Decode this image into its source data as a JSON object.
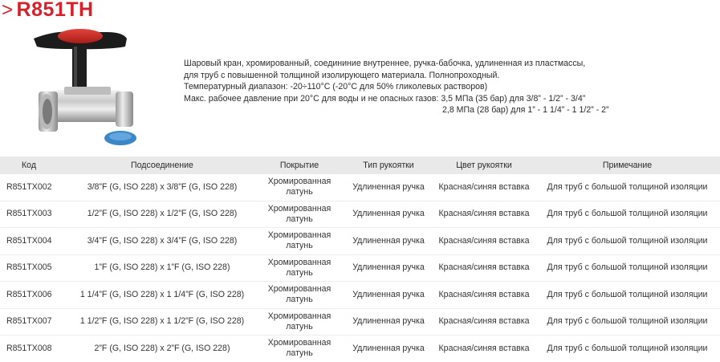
{
  "header": {
    "chevron": ">",
    "title": "R851TH"
  },
  "description": [
    "Шаровый кран, хромированный, соедининие внутреннее, ручка-бабочка, удлиненная из пластмассы,",
    "для труб с повышенной толщиной изолирующего материала. Полнопроходный.",
    "Температурный диапазон: -20÷110°C (-20°C для 50% гликолевых растворов)",
    "Макс. рабочее давление при 20°C для воды и не опасных газов: 3,5 МПа (35 бар) для 3/8” - 1/2” - 3/4”",
    "2,8 МПа (28 бар) для 1” - 1 1/4” - 1 1/2” - 2”"
  ],
  "table": {
    "headers": [
      "Код",
      "Подсоединение",
      "Покрытие",
      "Тип рукоятки",
      "Цвет рукоятки",
      "Примечание"
    ],
    "rows": [
      [
        "R851TX002",
        "3/8”F (G, ISO 228) x 3/8”F (G, ISO 228)",
        "Хромированная латунь",
        "Удлиненная ручка",
        "Красная/синяя вставка",
        "Для труб с большой толщиной изоляции"
      ],
      [
        "R851TX003",
        "1/2”F (G, ISO 228) x 1/2”F (G, ISO 228)",
        "Хромированная латунь",
        "Удлиненная ручка",
        "Красная/синяя вставка",
        "Для труб с большой толщиной изоляции"
      ],
      [
        "R851TX004",
        "3/4”F (G, ISO 228) x 3/4”F (G, ISO 228)",
        "Хромированная латунь",
        "Удлиненная ручка",
        "Красная/синяя вставка",
        "Для труб с большой толщиной изоляции"
      ],
      [
        "R851TX005",
        "1”F (G, ISO 228) x 1”F (G, ISO 228)",
        "Хромированная латунь",
        "Удлиненная ручка",
        "Красная/синяя вставка",
        "Для труб с большой толщиной изоляции"
      ],
      [
        "R851TX006",
        "1 1/4”F (G, ISO 228) x 1 1/4”F (G, ISO 228)",
        "Хромированная латунь",
        "Удлиненная ручка",
        "Красная/синяя вставка",
        "Для труб с большой толщиной изоляции"
      ],
      [
        "R851TX007",
        "1 1/2”F (G, ISO 228) x 1 1/2”F (G, ISO 228)",
        "Хромированная латунь",
        "Удлиненная ручка",
        "Красная/синяя вставка",
        "Для труб с большой толщиной изоляции"
      ],
      [
        "R851TX008",
        "2”F (G, ISO 228) x 2”F (G, ISO 228)",
        "Хромированная латунь",
        "Удлиненная ручка",
        "Красная/синяя вставка",
        "Для труб с большой толщиной изоляции"
      ]
    ]
  },
  "colors": {
    "brand": "#d8202a",
    "header_bg": "#e9e9e9",
    "handle": "#d42a24",
    "cap": "#3b86c6"
  },
  "icons": {
    "product": "ball-valve-image"
  }
}
